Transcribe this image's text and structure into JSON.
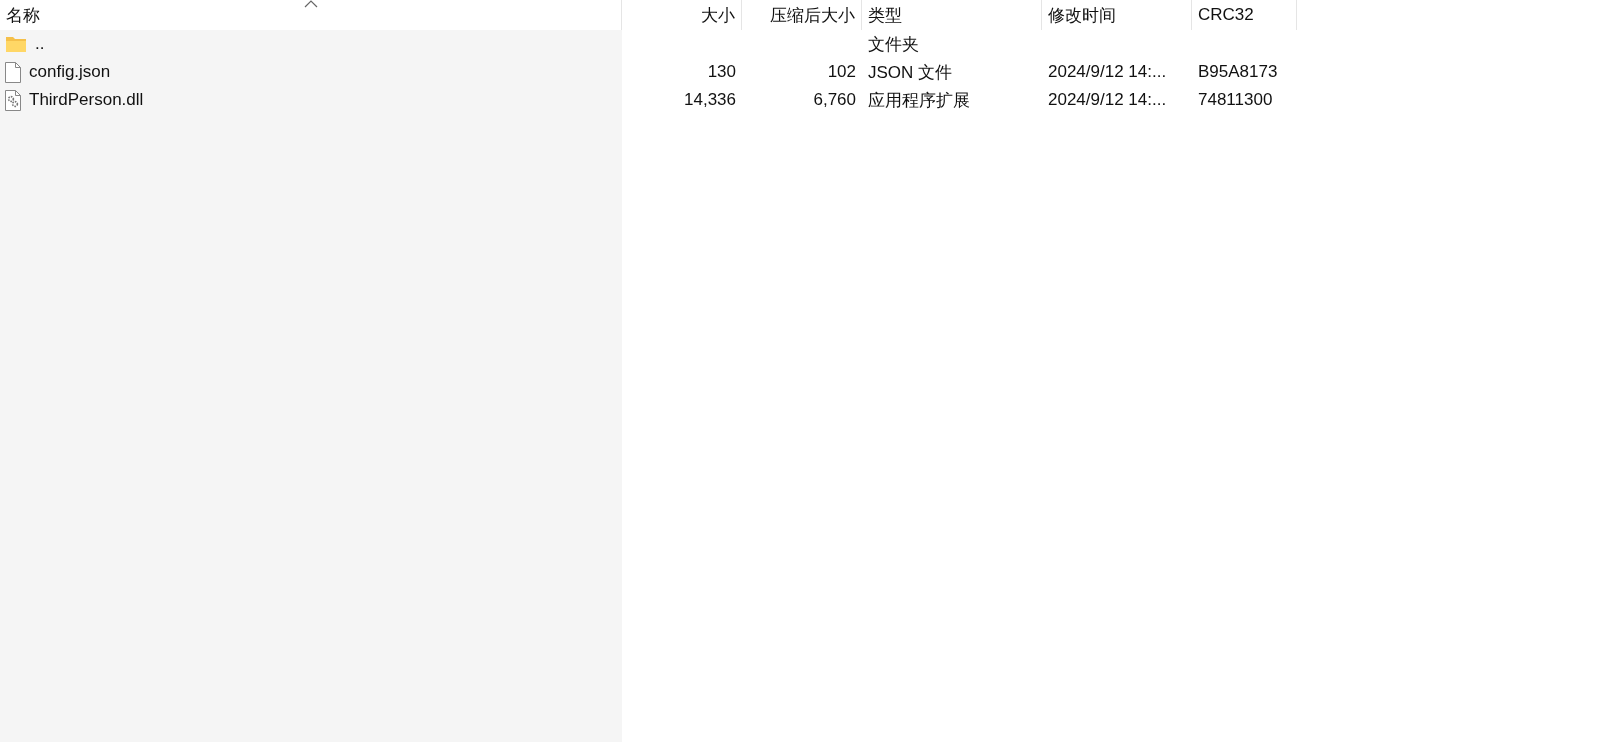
{
  "columns": [
    {
      "label": "名称",
      "sorted": true,
      "kind": "text"
    },
    {
      "label": "大小",
      "sorted": false,
      "kind": "number"
    },
    {
      "label": "压缩后大小",
      "sorted": false,
      "kind": "number"
    },
    {
      "label": "类型",
      "sorted": false,
      "kind": "text"
    },
    {
      "label": "修改时间",
      "sorted": false,
      "kind": "text"
    },
    {
      "label": "CRC32",
      "sorted": false,
      "kind": "text"
    }
  ],
  "rows": [
    {
      "kind": "folder",
      "cells": [
        "..",
        "",
        "",
        "文件夹",
        "",
        ""
      ]
    },
    {
      "kind": "file",
      "cells": [
        "config.json",
        "130",
        "102",
        "JSON 文件",
        "2024/9/12 14:...",
        "B95A8173"
      ]
    },
    {
      "kind": "dll",
      "cells": [
        "ThirdPerson.dll",
        "14,336",
        "6,760",
        "应用程序扩展",
        "2024/9/12 14:...",
        "74811300"
      ]
    }
  ]
}
